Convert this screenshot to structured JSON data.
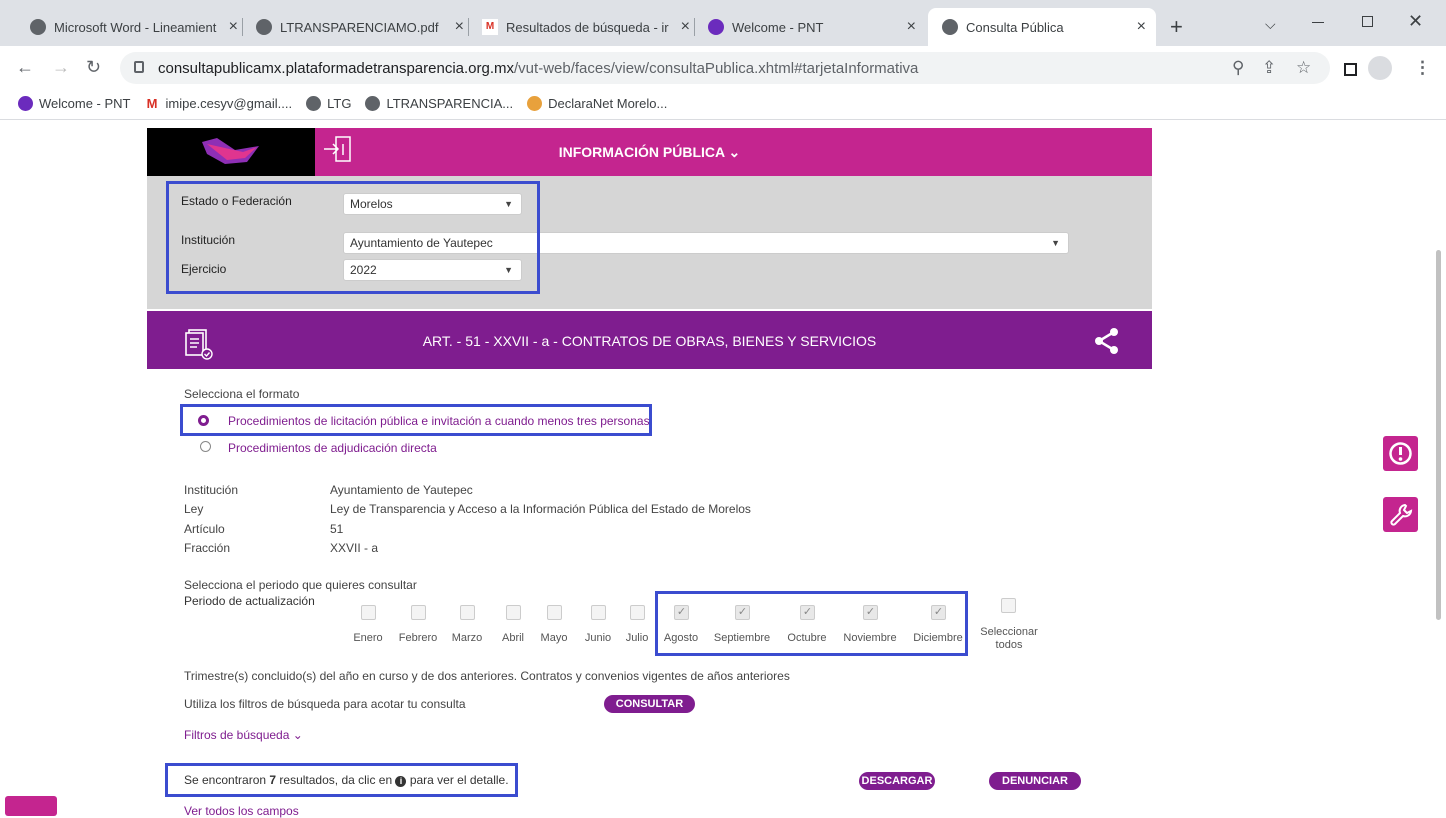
{
  "browser": {
    "tabs": [
      {
        "title": "Microsoft Word - Lineamient",
        "close": "×"
      },
      {
        "title": "LTRANSPARENCIAMO.pdf",
        "close": "×"
      },
      {
        "title": "Resultados de búsqueda - ir",
        "close": "×"
      },
      {
        "title": "Welcome - PNT",
        "close": "×"
      },
      {
        "title": "Consulta Pública",
        "close": "×"
      }
    ],
    "new_tab": "+",
    "url_host": "consultapublicamx.plataformadetransparencia.org.mx",
    "url_path": "/vut-web/faces/view/consultaPublica.xhtml#tarjetaInformativa",
    "bookmarks": [
      "Welcome - PNT",
      "imipe.cesyv@gmail....",
      "LTG",
      "LTRANSPARENCIA...",
      "DeclaraNet Morelo..."
    ]
  },
  "header": {
    "title": "INFORMACIÓN PÚBLICA ⌄"
  },
  "filters": {
    "estado_label": "Estado o Federación",
    "estado_value": "Morelos",
    "institucion_label": "Institución",
    "institucion_value": "Ayuntamiento de Yautepec",
    "ejercicio_label": "Ejercicio",
    "ejercicio_value": "2022"
  },
  "article": {
    "title": "ART. - 51 - XXVII - a - CONTRATOS DE OBRAS, BIENES Y SERVICIOS"
  },
  "format": {
    "label": "Selecciona el formato",
    "option1": "Procedimientos de licitación pública e invitación a cuando menos tres personas",
    "option2": "Procedimientos de adjudicación directa"
  },
  "details": {
    "institucion_label": "Institución",
    "institucion_value": "Ayuntamiento de Yautepec",
    "ley_label": "Ley",
    "ley_value": "Ley de Transparencia y Acceso a la Información Pública del Estado de Morelos",
    "articulo_label": "Artículo",
    "articulo_value": "51",
    "fraccion_label": "Fracción",
    "fraccion_value": "XXVII - a"
  },
  "period": {
    "label": "Selecciona el periodo que quieres consultar",
    "update_label": "Periodo de actualización",
    "months": [
      "Enero",
      "Febrero",
      "Marzo",
      "Abril",
      "Mayo",
      "Junio",
      "Julio",
      "Agosto",
      "Septiembre",
      "Octubre",
      "Noviembre",
      "Diciembre"
    ],
    "checked": [
      false,
      false,
      false,
      false,
      false,
      false,
      false,
      true,
      true,
      true,
      true,
      true
    ],
    "select_all_1": "Seleccionar",
    "select_all_2": "todos"
  },
  "notes": {
    "trimestre": "Trimestre(s) concluido(s) del año en curso y de dos anteriores. Contratos y convenios vigentes de años anteriores",
    "filtros_hint": "Utiliza los filtros de búsqueda para acotar tu consulta",
    "consultar": "CONSULTAR",
    "filtros_link": "Filtros de búsqueda ⌄"
  },
  "results": {
    "prefix": "Se encontraron ",
    "count": "7",
    "mid": " resultados, da clic en ",
    "suffix": " para ver el detalle.",
    "descargar": "DESCARGAR",
    "denunciar": "DENUNCIAR",
    "ver_todos": "Ver todos los campos"
  }
}
